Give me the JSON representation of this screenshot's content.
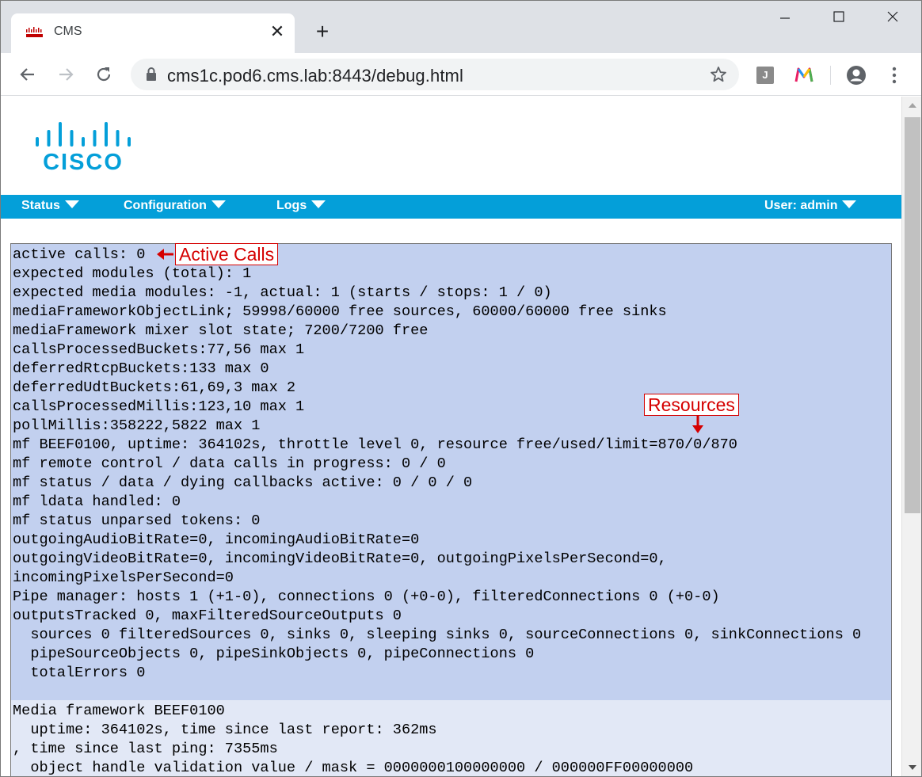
{
  "browser": {
    "tab_title": "CMS",
    "tab_close_glyph": "✕",
    "new_tab_glyph": "+",
    "url": "cms1c.pod6.cms.lab:8443/debug.html",
    "extension_j_label": "J"
  },
  "icons": {
    "back": "back-arrow-icon",
    "forward": "forward-arrow-icon",
    "reload": "reload-icon",
    "lock": "lock-icon",
    "bookmark": "star-icon",
    "profile": "account-circle-icon",
    "menu": "three-dot-menu-icon"
  },
  "colors": {
    "brand_blue": "#049fd9",
    "debug_block_primary": "#c2d0ef",
    "debug_block_secondary": "#e2e8f6",
    "annotation_red": "#d50000"
  },
  "nav": {
    "status": "Status",
    "configuration": "Configuration",
    "logs": "Logs",
    "user": "User: admin"
  },
  "logo_text": "CISCO",
  "debug": {
    "block1": [
      "active calls: 0",
      "expected modules (total): 1",
      "expected media modules: -1, actual: 1 (starts / stops: 1 / 0)",
      "mediaFrameworkObjectLink; 59998/60000 free sources, 60000/60000 free sinks",
      "mediaFramework mixer slot state; 7200/7200 free",
      "callsProcessedBuckets:77,56 max 1",
      "deferredRtcpBuckets:133 max 0",
      "deferredUdtBuckets:61,69,3 max 2",
      "callsProcessedMillis:123,10 max 1",
      "pollMillis:358222,5822 max 1",
      "mf BEEF0100, uptime: 364102s, throttle level 0, resource free/used/limit=870/0/870",
      "mf remote control / data calls in progress: 0 / 0",
      "mf status / data / dying callbacks active: 0 / 0 / 0",
      "mf ldata handled: 0",
      "mf status unparsed tokens: 0",
      "outgoingAudioBitRate=0, incomingAudioBitRate=0",
      "outgoingVideoBitRate=0, incomingVideoBitRate=0, outgoingPixelsPerSecond=0,",
      "incomingPixelsPerSecond=0",
      "Pipe manager: hosts 1 (+1-0), connections 0 (+0-0), filteredConnections 0 (+0-0)",
      "outputsTracked 0, maxFilteredSourceOutputs 0",
      "  sources 0 filteredSources 0, sinks 0, sleeping sinks 0, sourceConnections 0, sinkConnections 0",
      "  pipeSourceObjects 0, pipeSinkObjects 0, pipeConnections 0",
      "  totalErrors 0"
    ],
    "block2": [
      "Media framework BEEF0100",
      "  uptime: 364102s, time since last report: 362ms",
      ", time since last ping: 7355ms",
      "  object handle validation value / mask = 0000000100000000 / 000000FF00000000"
    ]
  },
  "annotations": {
    "active_calls": "Active Calls",
    "resources": "Resources"
  }
}
